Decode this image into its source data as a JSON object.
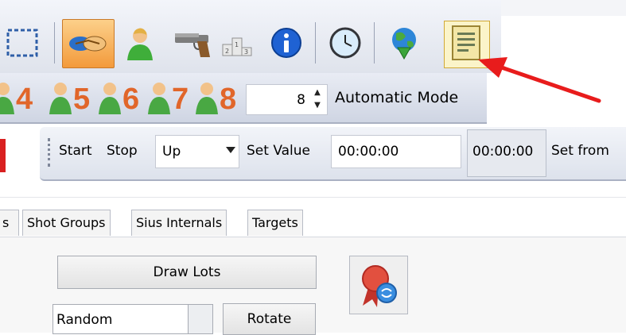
{
  "toolbar1": {
    "buttons": [
      {
        "name": "selection-icon",
        "active": false
      },
      {
        "name": "handshake-icon",
        "active": true
      },
      {
        "name": "user-icon",
        "active": false
      },
      {
        "name": "pistol-icon",
        "active": false
      },
      {
        "name": "podium-icon",
        "active": false
      },
      {
        "name": "info-icon",
        "active": false
      },
      {
        "name": "clock-icon",
        "active": false
      },
      {
        "name": "globe-download-icon",
        "active": false
      },
      {
        "name": "report-icon",
        "active": false,
        "highlighted": true
      }
    ]
  },
  "toolbar2": {
    "shooters": [
      "4",
      "5",
      "6",
      "7",
      "8"
    ],
    "spin_value": "8",
    "mode_label": "Automatic Mode"
  },
  "toolbar3": {
    "start_label": "Start",
    "stop_label": "Stop",
    "direction_value": "Up",
    "set_value_label": "Set Value",
    "set_value_input": "00:00:00",
    "timer_display": "00:00:00",
    "set_from_label": "Set from"
  },
  "tabs": [
    "s",
    "Shot Groups",
    "Sius Internals",
    "Targets"
  ],
  "panel": {
    "draw_lots_label": "Draw Lots",
    "random_value": "Random",
    "rotate_label": "Rotate"
  },
  "colors": {
    "annotation_arrow": "#e81c1c",
    "shooter_number": "#e1662a",
    "active_button": "#f6a24a"
  }
}
